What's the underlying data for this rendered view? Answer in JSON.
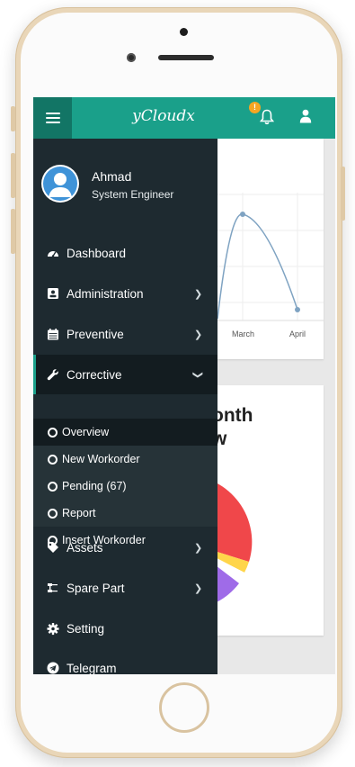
{
  "app": {
    "brand": "yCloudx"
  },
  "header": {
    "notification_count": "!"
  },
  "profile": {
    "name": "Ahmad",
    "role": "System Engineer"
  },
  "nav": [
    {
      "label": "Dashboard",
      "icon": "dashboard-icon",
      "has_submenu": false
    },
    {
      "label": "Administration",
      "icon": "id-card-icon",
      "has_submenu": true
    },
    {
      "label": "Preventive",
      "icon": "calendar-icon",
      "has_submenu": true
    },
    {
      "label": "Corrective",
      "icon": "wrench-icon",
      "has_submenu": true,
      "expanded": true
    },
    {
      "label": "Assets",
      "icon": "tag-icon",
      "has_submenu": true
    },
    {
      "label": "Spare Part",
      "icon": "spare-part-icon",
      "has_submenu": true
    },
    {
      "label": "Setting",
      "icon": "gear-icon",
      "has_submenu": false
    },
    {
      "label": "Telegram",
      "icon": "telegram-icon",
      "has_submenu": false
    }
  ],
  "corrective_submenu": [
    {
      "label": "Overview",
      "active": true
    },
    {
      "label": "New Workorder"
    },
    {
      "label": "Pending (67)"
    },
    {
      "label": "Report"
    },
    {
      "label": "Insert Workorder"
    }
  ],
  "background": {
    "chart_ticks": [
      "March",
      "April"
    ],
    "card_title_line1": "onth",
    "card_title_line2": "w"
  },
  "colors": {
    "topbar": "#1aa08a",
    "menu_button": "#127565",
    "sidebar": "#1e2a30",
    "badge": "#f5a623"
  }
}
